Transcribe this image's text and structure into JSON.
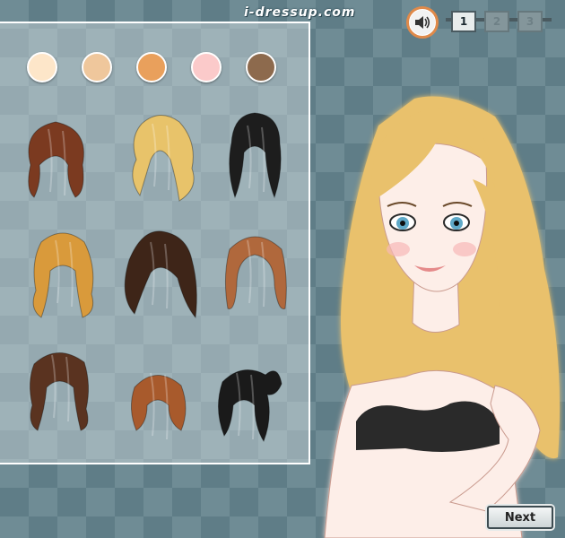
{
  "site": {
    "logo_text": "i-dressup.com"
  },
  "toolbar": {
    "sound_icon": "speaker-icon",
    "pages": [
      {
        "label": "1",
        "active": true
      },
      {
        "label": "2",
        "active": false
      },
      {
        "label": "3",
        "active": false
      }
    ]
  },
  "panel": {
    "swatches": [
      {
        "name": "swatch-pale-cream",
        "color": "#fde6c9"
      },
      {
        "name": "swatch-light-tan",
        "color": "#efc79c"
      },
      {
        "name": "swatch-orange",
        "color": "#e9a05c"
      },
      {
        "name": "swatch-pink",
        "color": "#fbcaca"
      },
      {
        "name": "swatch-brown",
        "color": "#8d6a4d"
      }
    ],
    "hairstyles": [
      {
        "name": "short-auburn-bob",
        "color": "#7b3a20"
      },
      {
        "name": "wavy-blonde",
        "color": "#e8c36a"
      },
      {
        "name": "black-updo",
        "color": "#1d1d1d"
      },
      {
        "name": "long-golden-wavy",
        "color": "#d99a3b"
      },
      {
        "name": "long-dark-brown",
        "color": "#3e2518"
      },
      {
        "name": "copper-with-bangs",
        "color": "#b0683c"
      },
      {
        "name": "dark-wavy-curls",
        "color": "#5a3320"
      },
      {
        "name": "short-auburn-bob-2",
        "color": "#a85a2c"
      },
      {
        "name": "black-side-ponytail",
        "color": "#1a1a1a"
      }
    ]
  },
  "model": {
    "hair_color": "#e9c16c",
    "skin_color": "#fdeee8",
    "top_color": "#2b2b2b",
    "eye_color": "#5fa9c8"
  },
  "actions": {
    "next_label": "Next"
  }
}
